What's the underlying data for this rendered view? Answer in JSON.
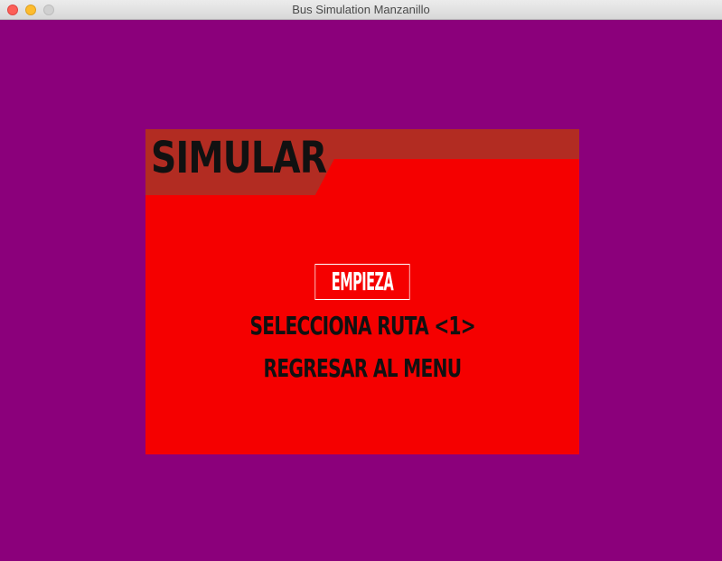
{
  "window": {
    "title": "Bus Simulation Manzanillo",
    "controls": [
      "close",
      "minimize",
      "maximize"
    ]
  },
  "colors": {
    "background": "#8b007b",
    "panel": "#f50000",
    "panel_header": "#b22c22",
    "text_dark": "#111111",
    "text_selected": "#ffffff"
  },
  "panel": {
    "title": "SIMULAR",
    "menu": {
      "start_label": "EMPIEZA",
      "route_label": "SELECCIONA RUTA <1>",
      "back_label": "REGRESAR AL MENU"
    }
  }
}
